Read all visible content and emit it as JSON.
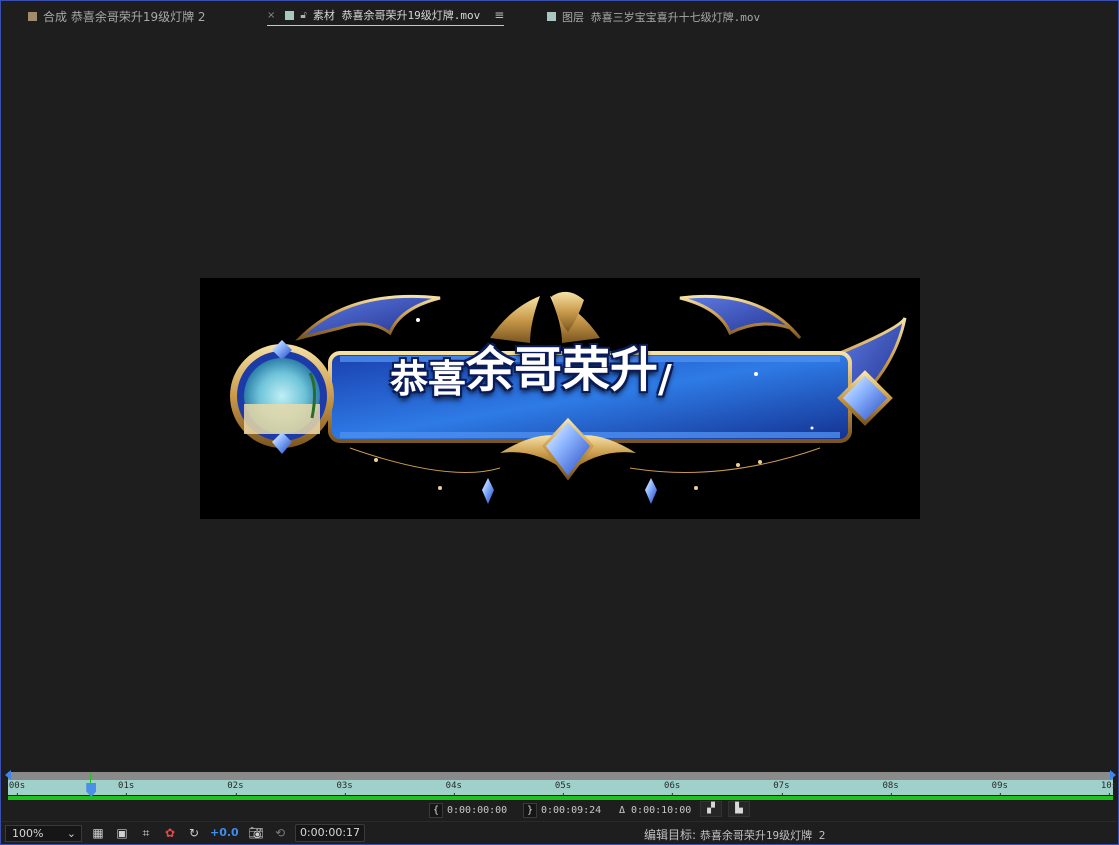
{
  "tabs": [
    {
      "label": "合成 恭喜余哥荣升19级灯牌 2",
      "color": "#a08c6c",
      "active": false
    },
    {
      "label": "素材 恭喜余哥荣升19级灯牌.mov",
      "color": "#a9c6c3",
      "active": true
    },
    {
      "label": "图层 恭喜三岁宝宝喜升十七级灯牌.mov",
      "color": "#a9c6c3",
      "active": false
    }
  ],
  "viewer": {
    "banner_text_small": "恭喜",
    "banner_text_big": "余哥荣升",
    "banner_text_tail": "/"
  },
  "timeline": {
    "ticks": [
      "00s",
      "01s",
      "02s",
      "03s",
      "04s",
      "05s",
      "06s",
      "07s",
      "08s",
      "09s",
      "10s"
    ],
    "playhead_seconds": 0.68
  },
  "readouts": {
    "in_point": "0:00:00:00",
    "out_point": "0:00:09:24",
    "duration": "Δ 0:00:10:00"
  },
  "toolbar": {
    "zoom": "100%",
    "exposure": "+0.0",
    "current_time": "0:00:00:17",
    "edit_target_label": "编辑目标:",
    "edit_target_value": "恭喜余哥荣升19级灯牌 2"
  }
}
